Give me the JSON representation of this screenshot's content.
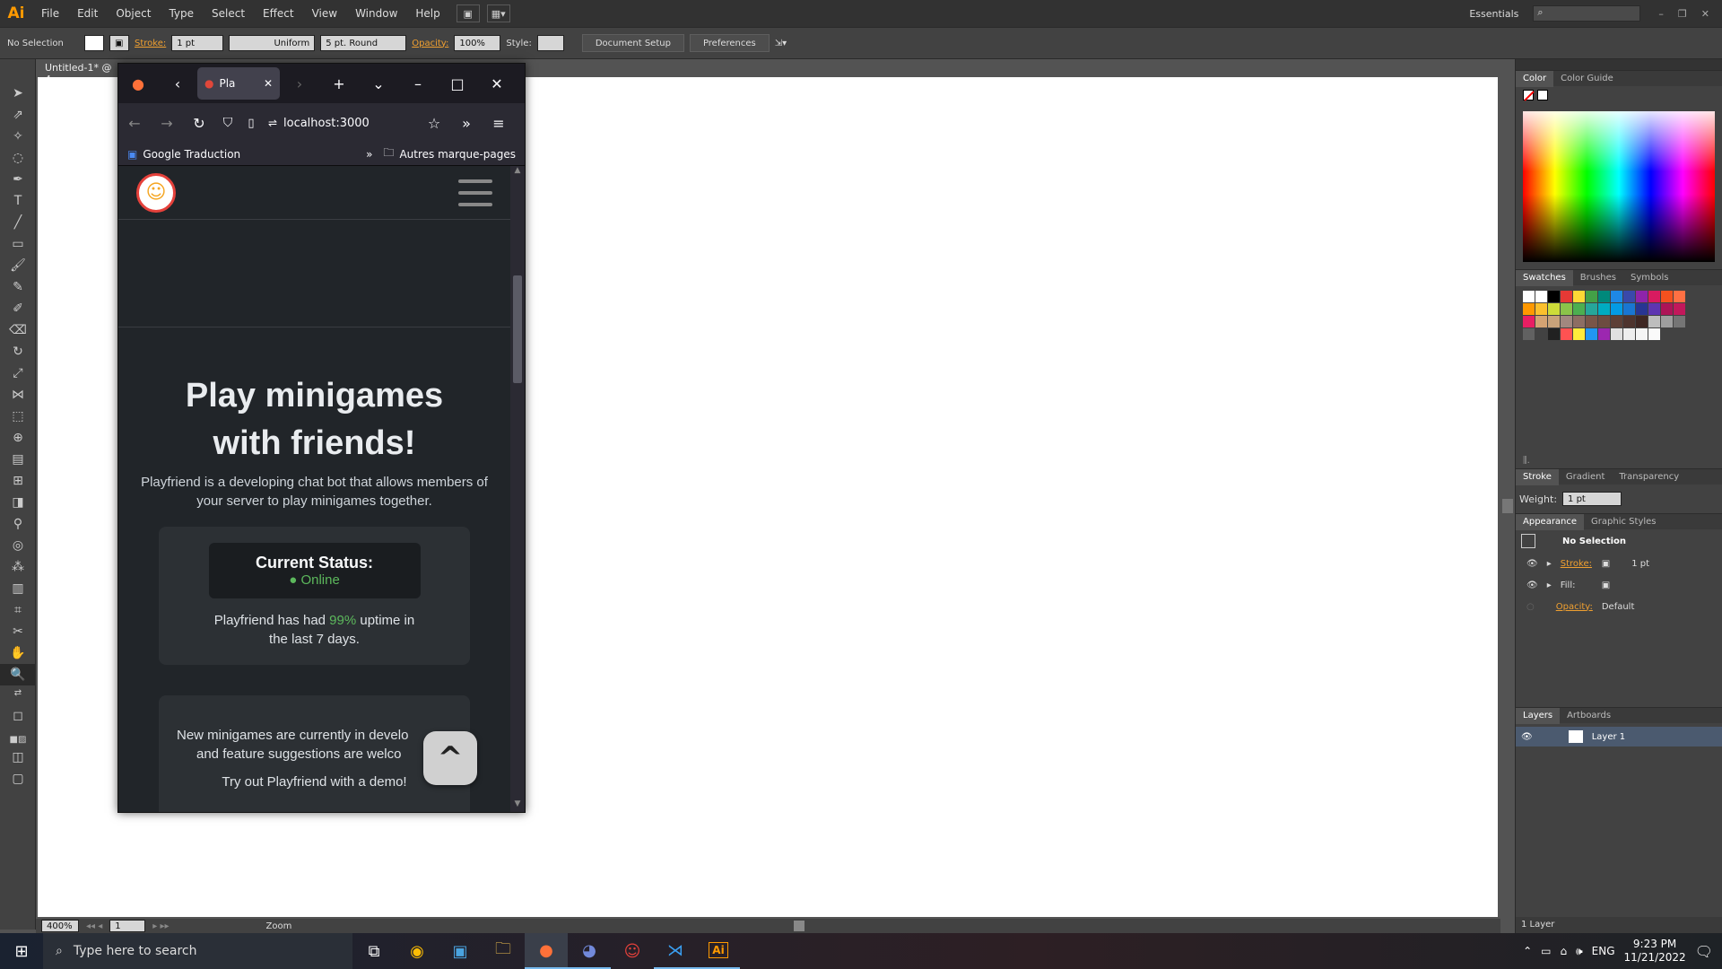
{
  "illustrator": {
    "logo": "Ai",
    "menus": [
      "File",
      "Edit",
      "Object",
      "Type",
      "Select",
      "Effect",
      "View",
      "Window",
      "Help"
    ],
    "workspace": "Essentials",
    "control_bar": {
      "selection": "No Selection",
      "stroke_label": "Stroke:",
      "stroke_weight": "1 pt",
      "stroke_profile": "Uniform",
      "brush": "5 pt. Round",
      "opacity_label": "Opacity:",
      "opacity": "100%",
      "style_label": "Style:",
      "document_setup": "Document Setup",
      "preferences": "Preferences"
    },
    "doc_tab": "Untitled-1* @ 4",
    "zoom": "400%",
    "artboard_num": "1",
    "status_label": "Zoom",
    "panels": {
      "color_tabs": [
        "Color",
        "Color Guide"
      ],
      "swatch_tabs": [
        "Swatches",
        "Brushes",
        "Symbols"
      ],
      "stroke_tabs": [
        "Stroke",
        "Gradient",
        "Transparency"
      ],
      "weight_label": "Weight:",
      "weight_value": "1 pt",
      "appearance_tabs": [
        "Appearance",
        "Graphic Styles"
      ],
      "appearance_title": "No Selection",
      "app_stroke_label": "Stroke:",
      "app_stroke_value": "1 pt",
      "app_fill_label": "Fill:",
      "app_opacity_label": "Opacity:",
      "app_opacity_value": "Default",
      "layers_tabs": [
        "Layers",
        "Artboards"
      ],
      "layer_name": "Layer 1",
      "layers_count": "1 Layer"
    }
  },
  "browser": {
    "tab_title": "Pla",
    "url": "localhost:3000",
    "bookmark_1": "Google Traduction",
    "bookmark_other": "Autres marque-pages"
  },
  "site": {
    "title_line1": "Play minigames",
    "title_line2": "with friends!",
    "subtitle": "Playfriend is a developing chat bot that allows members of your server to play minigames together.",
    "status_label": "Current Status:",
    "status_value": "Online",
    "uptime_prefix": "Playfriend has had ",
    "uptime_value": "99%",
    "uptime_suffix": " uptime in the last 7 days.",
    "news_line1": "New minigames are currently in develo",
    "news_line2": "and feature suggestions are welco",
    "demo": "Try out Playfriend with a demo!"
  },
  "taskbar": {
    "search_placeholder": "Type here to search",
    "lang": "ENG",
    "time": "9:23 PM",
    "date": "11/21/2022"
  },
  "colors": {
    "ai_orange": "#ff9a00",
    "online_green": "#5cb85c"
  }
}
